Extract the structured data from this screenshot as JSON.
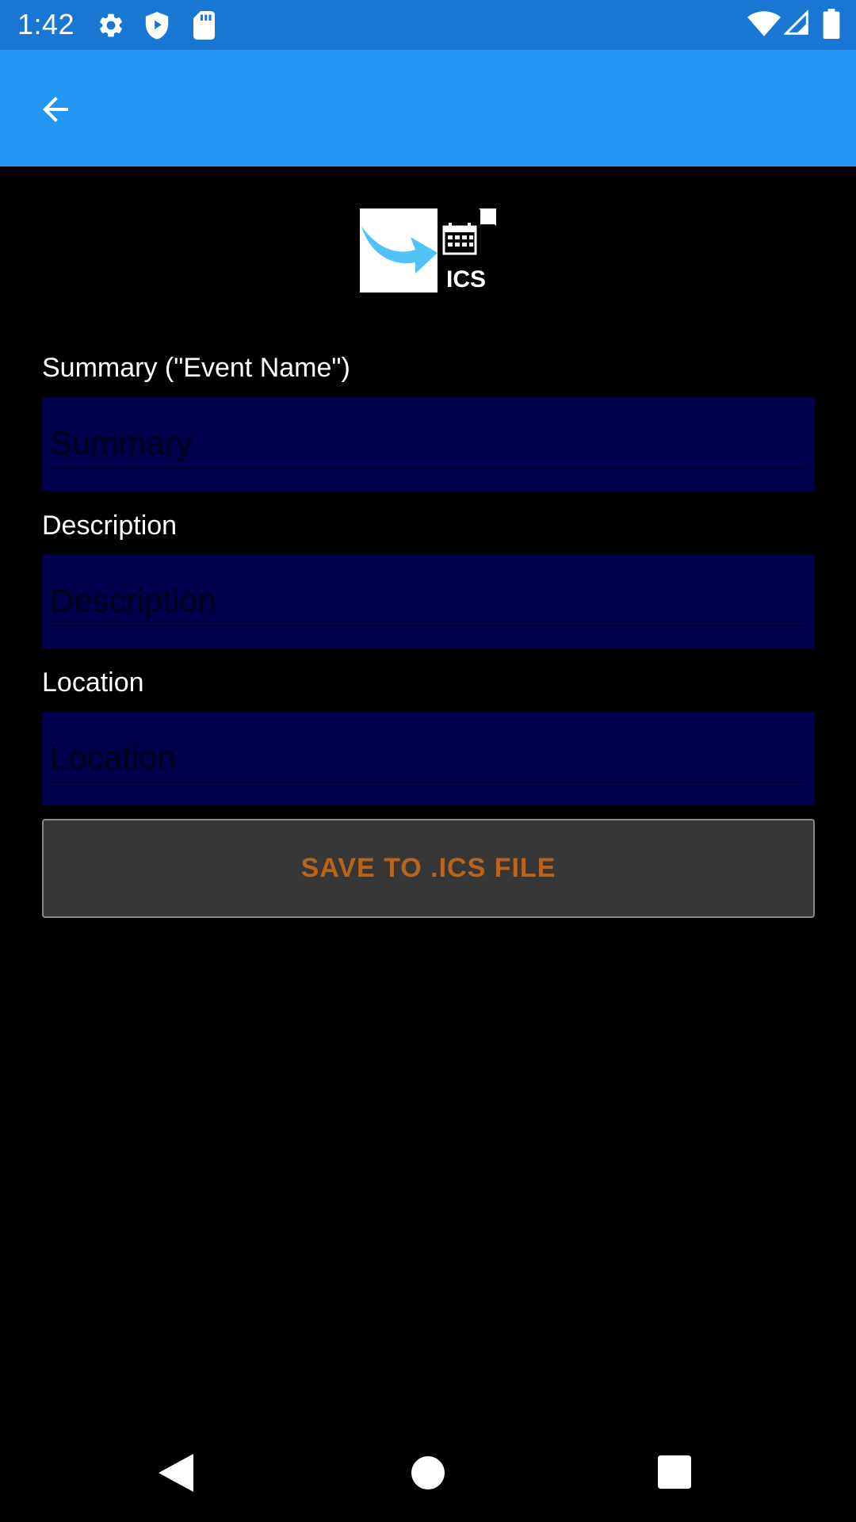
{
  "status_bar": {
    "time": "1:42",
    "left_icons": [
      "gear-icon",
      "shield-play-icon",
      "sd-card-icon"
    ],
    "right_icons": [
      "wifi-icon",
      "signal-icon",
      "battery-icon"
    ]
  },
  "app_bar": {
    "back_icon": "arrow-left-icon",
    "color": "#2196F3"
  },
  "logo": {
    "badge_text": "ICS",
    "arrow_color": "#4FC3F7"
  },
  "form": {
    "summary": {
      "label": "Summary (\"Event Name\")",
      "placeholder": "Summary",
      "value": ""
    },
    "description": {
      "label": "Description",
      "placeholder": "Description",
      "value": ""
    },
    "location": {
      "label": "Location",
      "placeholder": "Location",
      "value": ""
    },
    "field_background": "#00004D",
    "save_label": "SAVE TO .ICS FILE",
    "save_text_color": "#B8651B"
  },
  "nav_bar": {
    "icons": [
      "nav-back-icon",
      "nav-home-icon",
      "nav-recents-icon"
    ]
  }
}
